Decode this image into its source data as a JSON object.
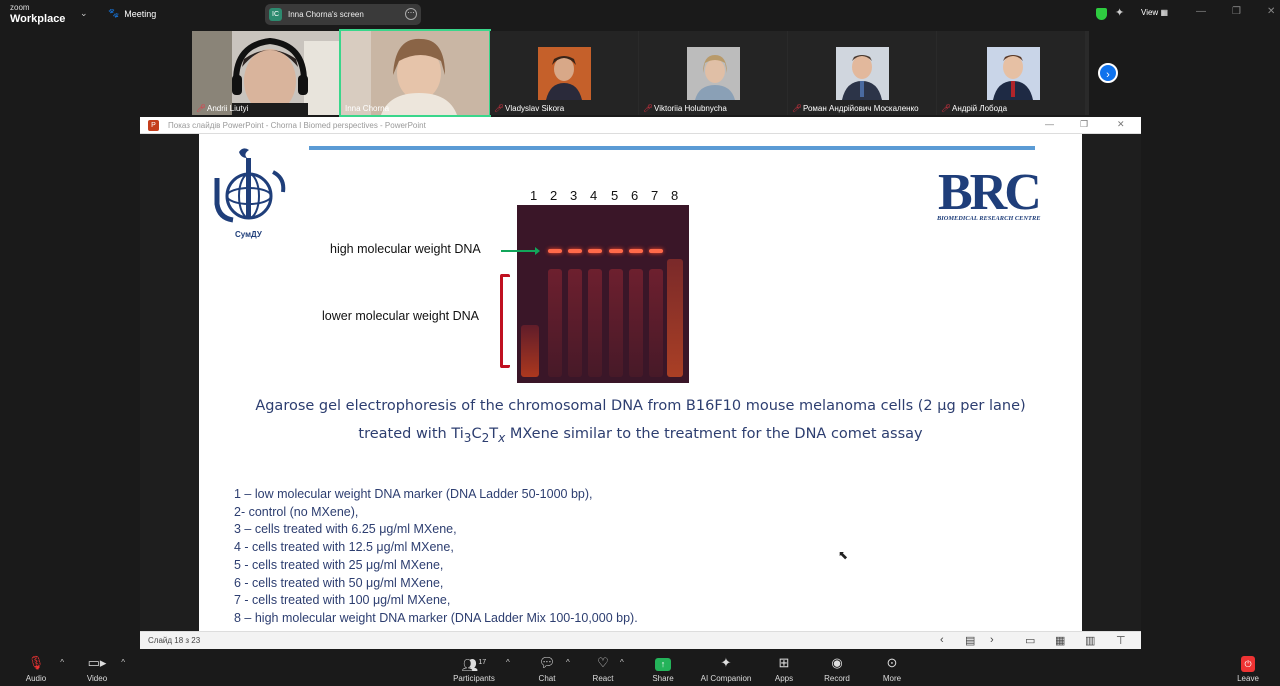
{
  "topbar": {
    "brand_line1": "zoom",
    "brand_line2": "Workplace",
    "meeting_label": "Meeting",
    "screen_share_initials": "IC",
    "screen_share_label": "Inna Chorna's screen",
    "view_label": "View"
  },
  "participants": [
    {
      "name": "Andrii Liutyi",
      "muted": true
    },
    {
      "name": "Inna Chorna",
      "muted": false,
      "active": true
    },
    {
      "name": "Vladyslav Sikora",
      "muted": true
    },
    {
      "name": "Viktoriia Holubnycha",
      "muted": true
    },
    {
      "name": "Роман Андрійович Москаленко",
      "muted": true
    },
    {
      "name": "Андрій Лобода",
      "muted": true
    }
  ],
  "ppt": {
    "window_title": "Показ слайдів PowerPoint  -  Chorna I Biomed perspectives - PowerPoint",
    "slide_counter": "Слайд 18 з 23"
  },
  "slide": {
    "sumdu_caption": "СумДУ",
    "brc_big": "BRC",
    "brc_sub": "BIOMEDICAL RESEARCH CENTRE",
    "lane_numbers": [
      "1",
      "2",
      "3",
      "4",
      "5",
      "6",
      "7",
      "8"
    ],
    "label_high": "high molecular weight DNA",
    "label_low": "lower molecular weight DNA",
    "caption_line1": "Agarose gel electrophoresis of the chromosomal DNA from B16F10 mouse melanoma cells (2 μg per lane)",
    "caption_line2_a": "treated with Ti",
    "caption_line2_sub1": "3",
    "caption_line2_b": "C",
    "caption_line2_sub2": "2",
    "caption_line2_c": "T",
    "caption_line2_sub3": "x",
    "caption_line2_d": " MXene similar to the treatment for the DNA comet assay",
    "legend": [
      "1 – low molecular weight DNA marker (DNA Ladder 50-1000 bp),",
      "2- control (no MXene),",
      "3 – cells treated with 6.25 μg/ml MXene,",
      "4 - cells treated with 12.5 μg/ml MXene,",
      "5 - cells treated with 25 μg/ml MXene,",
      "6 - cells treated with 50 μg/ml MXene,",
      "7 - cells treated with 100 μg/ml MXene,",
      "8 – high molecular weight DNA marker (DNA Ladder Mix 100-10,000 bp)."
    ]
  },
  "toolbar": {
    "audio": "Audio",
    "video": "Video",
    "participants": "Participants",
    "participants_count": "17",
    "chat": "Chat",
    "react": "React",
    "share": "Share",
    "ai_companion": "AI Companion",
    "apps": "Apps",
    "record": "Record",
    "more": "More",
    "leave": "Leave"
  }
}
